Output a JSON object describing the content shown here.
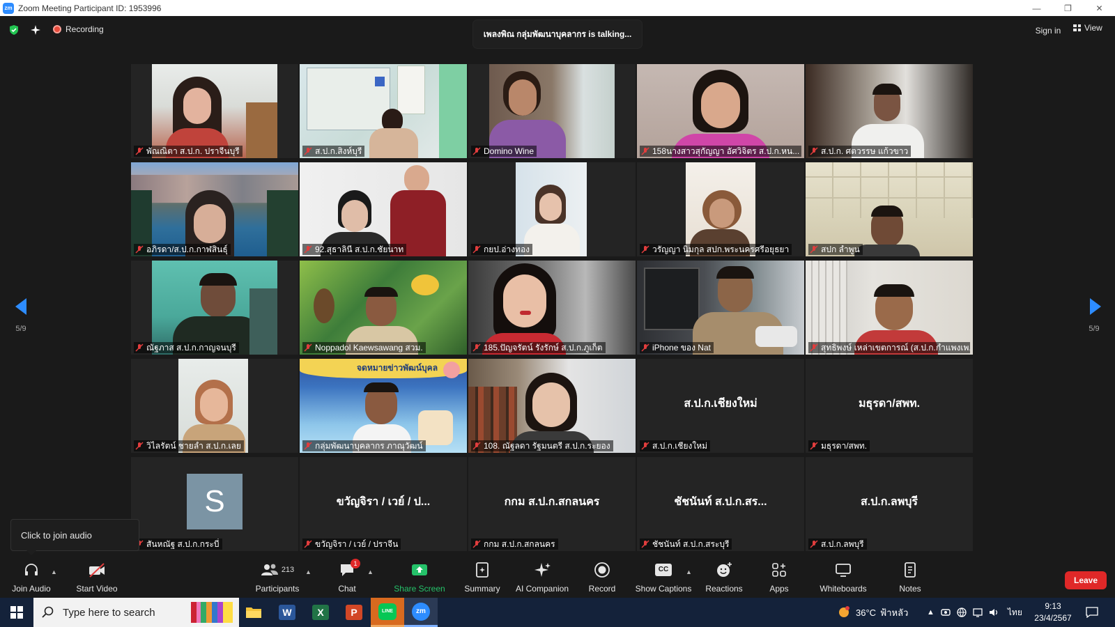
{
  "window": {
    "title": "Zoom Meeting Participant ID: 1953996",
    "logo": "zm"
  },
  "topbar": {
    "recording_label": "Recording",
    "talking_text": "เพลงพิณ กลุ่มพัฒนาบุคลากร is  talking...",
    "signin_label": "Sign in",
    "view_label": "View"
  },
  "gallery": {
    "page_left": "5/9",
    "page_right": "5/9",
    "tiles": [
      {
        "name": "พัณณิตา ส.ป.ก. ปราจีนบุรี"
      },
      {
        "name": "ส.ป.ก.สิงห์บุรี"
      },
      {
        "name": "Domino Wine"
      },
      {
        "name": "158นางสาวสุกัญญา อัศวิจิตร ส.ป.ก.หน..."
      },
      {
        "name": "ส.ป.ก. ศตวรรษ แก้วขาว"
      },
      {
        "name": "อภิรดา/ส.ป.ก.กาฬสินธุ์"
      },
      {
        "name": "92.สุธาลินี ส.ป.ก.ชัยนาท"
      },
      {
        "name": "กยป.อ่างทอง"
      },
      {
        "name": "วรัญญา นิมกุล สปก.พระนครศรีอยุธยา"
      },
      {
        "name": "สปก ลำพูน"
      },
      {
        "name": "ณัฐภาส ส.ป.ก.กาญจนบุรี"
      },
      {
        "name": "Noppadol Kaewsawang สวม."
      },
      {
        "name": "185.ปัญจรัตน์ รังรักษ์ ส.ป.ก.ภูเก็ต"
      },
      {
        "name": "iPhone ของ Nat"
      },
      {
        "name": "สุทธิพงษ์ เหล่าเขตการณ์ (ส.ป.ก.กำแพงเพ..."
      },
      {
        "name": "วิไลรัตน์ ชายลำ ส.ป.ก.เลย"
      },
      {
        "name": "กลุ่มพัฒนาบุคลากร ภาณุวัฒน์"
      },
      {
        "name": "108. ณัฐลดา รัฐมนตรี ส.ป.ก.ระยอง"
      },
      {
        "name": "ส.ป.ก.เชียงใหม่",
        "big": "ส.ป.ก.เชียงใหม่"
      },
      {
        "name": "มธุรดา/สพท.",
        "big": "มธุรดา/สพท."
      },
      {
        "name": "สันหณัฐ ส.ป.ก.กระบี่",
        "avatar": "S"
      },
      {
        "name": "ขวัญจิรา / เวย์ / ปราจีน",
        "big": "ขวัญจิรา / เวย์ / ป..."
      },
      {
        "name": "กกม ส.ป.ก.สกลนคร",
        "big": "กกม ส.ป.ก.สกลนคร"
      },
      {
        "name": "ชัชนันท์ ส.ป.ก.สระบุรี",
        "big": "ชัชนันท์ ส.ป.ก.สร..."
      },
      {
        "name": "ส.ป.ก.ลพบุรี",
        "big": "ส.ป.ก.ลพบุรี"
      }
    ],
    "banner_text": "จดหมายข่าวพัฒน์บุคล"
  },
  "tooltip": {
    "text": "Click to join audio"
  },
  "toolbar": {
    "join_audio": "Join Audio",
    "start_video": "Start Video",
    "participants": "Participants",
    "participant_count": "213",
    "chat": "Chat",
    "chat_badge": "1",
    "share_screen": "Share Screen",
    "summary": "Summary",
    "ai_companion": "AI Companion",
    "record": "Record",
    "show_captions": "Show Captions",
    "captions_icon_text": "CC",
    "reactions": "Reactions",
    "apps": "Apps",
    "whiteboards": "Whiteboards",
    "notes": "Notes",
    "leave": "Leave"
  },
  "taskbar": {
    "search_placeholder": "Type here to search",
    "temperature": "36°C",
    "weather": "ฟ้าหลัว",
    "language": "ไทย",
    "time": "9:13",
    "date": "23/4/2567",
    "apps": [
      "file-explorer",
      "word",
      "excel",
      "powerpoint",
      "line",
      "zoom"
    ],
    "word_letter": "W",
    "excel_letter": "X",
    "ppt_letter": "P",
    "line_text": "LINE",
    "zoom_text": "zm"
  }
}
